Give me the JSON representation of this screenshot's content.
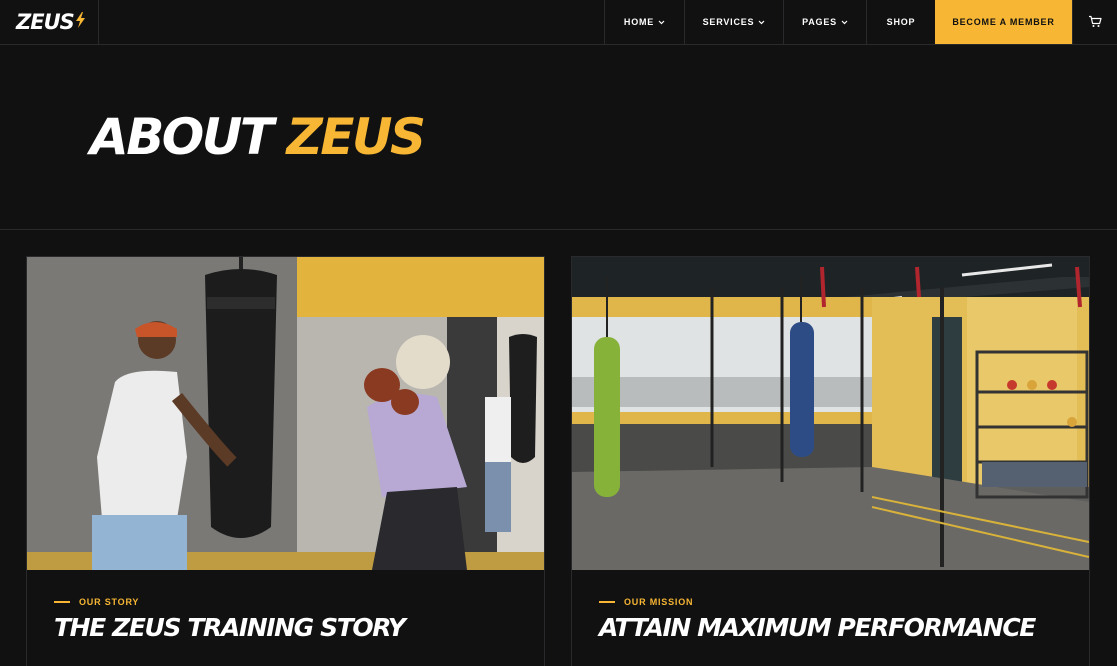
{
  "brand": {
    "name": "ZEUS",
    "accent_color": "#f7b633"
  },
  "nav": {
    "items": [
      {
        "label": "HOME",
        "dropdown": true
      },
      {
        "label": "SERVICES",
        "dropdown": true
      },
      {
        "label": "PAGES",
        "dropdown": true
      },
      {
        "label": "SHOP",
        "dropdown": false
      }
    ],
    "cta_label": "BECOME A MEMBER",
    "cart_icon": "cart-icon"
  },
  "hero": {
    "title_main": "ABOUT",
    "title_accent": "ZEUS"
  },
  "cards": [
    {
      "eyebrow": "OUR STORY",
      "title": "THE ZEUS TRAINING STORY",
      "body": "",
      "image": "boxing-training-photo"
    },
    {
      "eyebrow": "OUR MISSION",
      "title": "ATTAIN MAXIMUM PERFORMANCE",
      "body": "",
      "image": "gym-interior-photo"
    }
  ]
}
